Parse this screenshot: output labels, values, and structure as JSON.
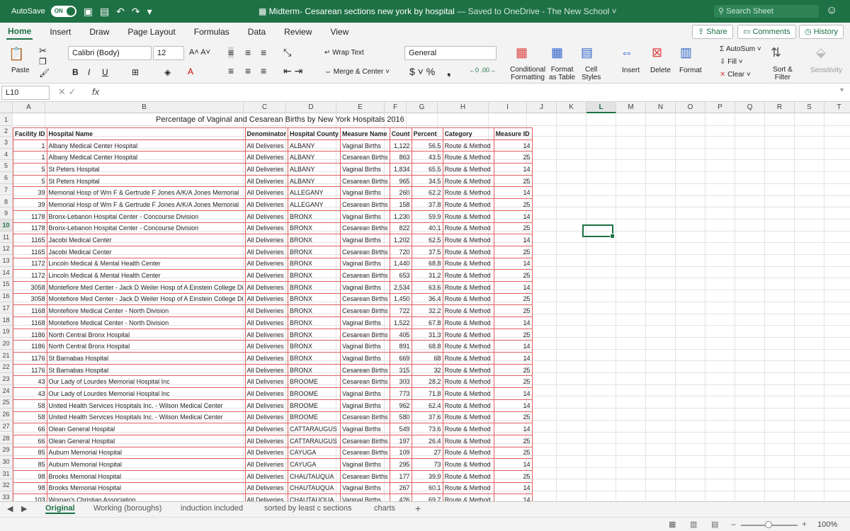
{
  "titlebar": {
    "autosave_label": "AutoSave",
    "autosave_state": "ON",
    "doc_title": "Midterm- Cesarean sections new york by hospital",
    "saved_text": "— Saved to OneDrive - The New School ˅",
    "search_placeholder": "Search Sheet"
  },
  "tabs": [
    "Home",
    "Insert",
    "Draw",
    "Page Layout",
    "Formulas",
    "Data",
    "Review",
    "View"
  ],
  "top_buttons": {
    "share": "Share",
    "comments": "Comments",
    "history": "History"
  },
  "ribbon": {
    "paste": "Paste",
    "font_name": "Calibri (Body)",
    "font_size": "12",
    "wrap_text": "Wrap Text",
    "merge_center": "Merge & Center",
    "number_format": "General",
    "conditional": "Conditional",
    "formatting": "Formatting",
    "format_label": "Format",
    "as_table": "as Table",
    "cell": "Cell",
    "styles": "Styles",
    "insert": "Insert",
    "delete": "Delete",
    "format": "Format",
    "autosum": "AutoSum",
    "fill": "Fill",
    "clear": "Clear",
    "sort": "Sort &",
    "filter": "Filter",
    "sensitivity": "Sensitivity"
  },
  "formula_bar": {
    "name_box": "L10",
    "fx": "fx",
    "value": ""
  },
  "columns": [
    "A",
    "B",
    "C",
    "D",
    "E",
    "F",
    "G",
    "H",
    "I",
    "J",
    "K",
    "L",
    "M",
    "N",
    "O",
    "P",
    "Q",
    "R",
    "S",
    "T"
  ],
  "rows": [
    "1",
    "2",
    "3",
    "4",
    "5",
    "6",
    "7",
    "8",
    "9",
    "10",
    "11",
    "12",
    "13",
    "14",
    "15",
    "16",
    "17",
    "18",
    "19",
    "20",
    "21",
    "22",
    "23",
    "24",
    "25",
    "26",
    "27",
    "28",
    "29",
    "30",
    "31",
    "32",
    "33"
  ],
  "sheet_title": "Percentage of Vaginal and Cesarean Births by New York Hospitals 2016",
  "headers": [
    "Facility ID",
    "Hospital Name",
    "Denominator",
    "Hospital County",
    "Measure Name",
    "Count",
    "Percent",
    "Category",
    "Measure ID"
  ],
  "table": [
    [
      "1",
      "Albany Medical Center Hospital",
      "All Deliveries",
      "ALBANY",
      "Vaginal Births",
      "1,122",
      "56.5",
      "Route & Method",
      "14"
    ],
    [
      "1",
      "Albany Medical Center Hospital",
      "All Deliveries",
      "ALBANY",
      "Cesarean Births",
      "863",
      "43.5",
      "Route & Method",
      "25"
    ],
    [
      "5",
      "St Peters Hospital",
      "All Deliveries",
      "ALBANY",
      "Vaginal Births",
      "1,834",
      "65.5",
      "Route & Method",
      "14"
    ],
    [
      "5",
      "St Peters Hospital",
      "All Deliveries",
      "ALBANY",
      "Cesarean Births",
      "965",
      "34.5",
      "Route & Method",
      "25"
    ],
    [
      "39",
      "Memorial Hosp of Wm F & Gertrude F Jones A/K/A Jones Memorial",
      "All Deliveries",
      "ALLEGANY",
      "Vaginal Births",
      "260",
      "62.2",
      "Route & Method",
      "14"
    ],
    [
      "39",
      "Memorial Hosp of Wm F & Gertrude F Jones A/K/A Jones Memorial",
      "All Deliveries",
      "ALLEGANY",
      "Cesarean Births",
      "158",
      "37.8",
      "Route & Method",
      "25"
    ],
    [
      "1178",
      "Bronx-Lebanon Hospital Center - Concourse Division",
      "All Deliveries",
      "BRONX",
      "Vaginal Births",
      "1,230",
      "59.9",
      "Route & Method",
      "14"
    ],
    [
      "1178",
      "Bronx-Lebanon Hospital Center - Concourse Division",
      "All Deliveries",
      "BRONX",
      "Cesarean Births",
      "822",
      "40.1",
      "Route & Method",
      "25"
    ],
    [
      "1165",
      "Jacobi Medical Center",
      "All Deliveries",
      "BRONX",
      "Vaginal Births",
      "1,202",
      "62.5",
      "Route & Method",
      "14"
    ],
    [
      "1165",
      "Jacobi Medical Center",
      "All Deliveries",
      "BRONX",
      "Cesarean Births",
      "720",
      "37.5",
      "Route & Method",
      "25"
    ],
    [
      "1172",
      "Lincoln Medical & Mental Health Center",
      "All Deliveries",
      "BRONX",
      "Vaginal Births",
      "1,440",
      "68.8",
      "Route & Method",
      "14"
    ],
    [
      "1172",
      "Lincoln Medical & Mental Health Center",
      "All Deliveries",
      "BRONX",
      "Cesarean Births",
      "653",
      "31.2",
      "Route & Method",
      "25"
    ],
    [
      "3058",
      "Montefiore Med Center - Jack D Weiler Hosp of A Einstein College Di",
      "All Deliveries",
      "BRONX",
      "Vaginal Births",
      "2,534",
      "63.6",
      "Route & Method",
      "14"
    ],
    [
      "3058",
      "Montefiore Med Center - Jack D Weiler Hosp of A Einstein College Di",
      "All Deliveries",
      "BRONX",
      "Cesarean Births",
      "1,450",
      "36.4",
      "Route & Method",
      "25"
    ],
    [
      "1168",
      "Montefiore Medical Center - North Division",
      "All Deliveries",
      "BRONX",
      "Cesarean Births",
      "722",
      "32.2",
      "Route & Method",
      "25"
    ],
    [
      "1168",
      "Montefiore Medical Center - North Division",
      "All Deliveries",
      "BRONX",
      "Vaginal Births",
      "1,522",
      "67.8",
      "Route & Method",
      "14"
    ],
    [
      "1186",
      "North Central Bronx Hospital",
      "All Deliveries",
      "BRONX",
      "Cesarean Births",
      "405",
      "31.3",
      "Route & Method",
      "25"
    ],
    [
      "1186",
      "North Central Bronx Hospital",
      "All Deliveries",
      "BRONX",
      "Vaginal Births",
      "891",
      "68.8",
      "Route & Method",
      "14"
    ],
    [
      "1176",
      "St Barnabas Hospital",
      "All Deliveries",
      "BRONX",
      "Vaginal Births",
      "669",
      "68",
      "Route & Method",
      "14"
    ],
    [
      "1176",
      "St Barnabas Hospital",
      "All Deliveries",
      "BRONX",
      "Cesarean Births",
      "315",
      "32",
      "Route & Method",
      "25"
    ],
    [
      "43",
      "Our Lady of Lourdes Memorial Hospital Inc",
      "All Deliveries",
      "BROOME",
      "Cesarean Births",
      "303",
      "28.2",
      "Route & Method",
      "25"
    ],
    [
      "43",
      "Our Lady of Lourdes Memorial Hospital Inc",
      "All Deliveries",
      "BROOME",
      "Vaginal Births",
      "773",
      "71.8",
      "Route & Method",
      "14"
    ],
    [
      "58",
      "United Health Services Hospitals Inc. - Wilson Medical Center",
      "All Deliveries",
      "BROOME",
      "Vaginal Births",
      "962",
      "62.4",
      "Route & Method",
      "14"
    ],
    [
      "58",
      "United Health Services Hospitals Inc. - Wilson Medical Center",
      "All Deliveries",
      "BROOME",
      "Cesarean Births",
      "580",
      "37.6",
      "Route & Method",
      "25"
    ],
    [
      "66",
      "Olean General Hospital",
      "All Deliveries",
      "CATTARAUGUS",
      "Vaginal Births",
      "549",
      "73.6",
      "Route & Method",
      "14"
    ],
    [
      "66",
      "Olean General Hospital",
      "All Deliveries",
      "CATTARAUGUS",
      "Cesarean Births",
      "197",
      "26.4",
      "Route & Method",
      "25"
    ],
    [
      "85",
      "Auburn Memorial Hospital",
      "All Deliveries",
      "CAYUGA",
      "Cesarean Births",
      "109",
      "27",
      "Route & Method",
      "25"
    ],
    [
      "85",
      "Auburn Memorial Hospital",
      "All Deliveries",
      "CAYUGA",
      "Vaginal Births",
      "295",
      "73",
      "Route & Method",
      "14"
    ],
    [
      "98",
      "Brooks Memorial Hospital",
      "All Deliveries",
      "CHAUTAUQUA",
      "Cesarean Births",
      "177",
      "39.9",
      "Route & Method",
      "25"
    ],
    [
      "98",
      "Brooks Memorial Hospital",
      "All Deliveries",
      "CHAUTAUQUA",
      "Vaginal Births",
      "267",
      "60.1",
      "Route & Method",
      "14"
    ],
    [
      "103",
      "Woman's Christian Association",
      "All Deliveries",
      "CHAUTAUQUA",
      "Vaginal Births",
      "426",
      "69.7",
      "Route & Method",
      "14"
    ]
  ],
  "sheets": [
    "Original",
    "Working (boroughs)",
    "induction included",
    "sorted by least c sections",
    "charts"
  ],
  "status": {
    "zoom": "100%"
  }
}
